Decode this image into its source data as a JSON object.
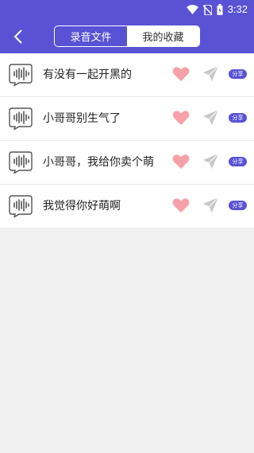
{
  "status_bar": {
    "time": "3:32"
  },
  "header": {
    "tabs": [
      {
        "label": "录音文件",
        "active": false
      },
      {
        "label": "我的收藏",
        "active": true
      }
    ]
  },
  "favorites": [
    {
      "title": "有没有一起开黑的",
      "share_label": "分享"
    },
    {
      "title": "小哥哥别生气了",
      "share_label": "分享"
    },
    {
      "title": "小哥哥，我给你卖个萌",
      "share_label": "分享"
    },
    {
      "title": "我觉得你好萌啊",
      "share_label": "分享"
    }
  ],
  "colors": {
    "accent": "#5a52d5",
    "heart": "#f6a1a8",
    "send": "#c8c8c8",
    "background": "#f0f0f0"
  }
}
